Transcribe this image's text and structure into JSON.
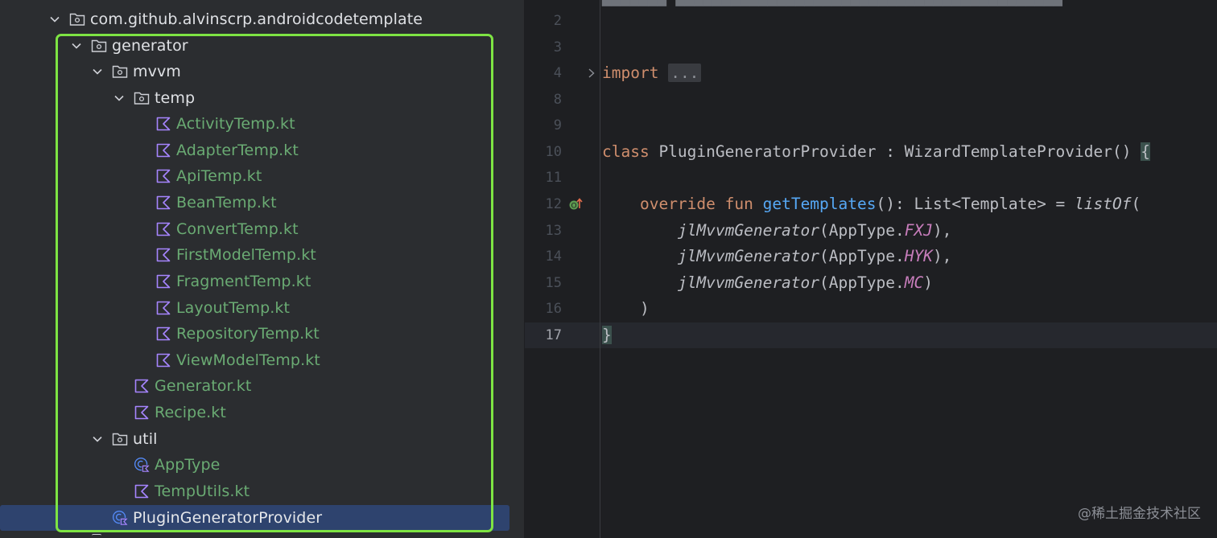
{
  "tree": {
    "root_package": "com.github.alvinscrp.androidcodetemplate",
    "generator": "generator",
    "mvvm": "mvvm",
    "temp": "temp",
    "temp_files": [
      "ActivityTemp.kt",
      "AdapterTemp.kt",
      "ApiTemp.kt",
      "BeanTemp.kt",
      "ConvertTemp.kt",
      "FirstModelTemp.kt",
      "FragmentTemp.kt",
      "LayoutTemp.kt",
      "RepositoryTemp.kt",
      "ViewModelTemp.kt"
    ],
    "mvvm_files": [
      "Generator.kt",
      "Recipe.kt"
    ],
    "util": "util",
    "util_files": [
      "AppType",
      "TempUtils.kt"
    ],
    "selected": "PluginGeneratorProvider"
  },
  "editor": {
    "line_numbers": [
      "2",
      "3",
      "4",
      "8",
      "9",
      "10",
      "11",
      "12",
      "13",
      "14",
      "15",
      "16",
      "17"
    ],
    "l4": {
      "kw": "import",
      "dots": "..."
    },
    "l10": {
      "kw": "class",
      "rest": " PluginGeneratorProvider : WizardTemplateProvider() ",
      "brace": "{"
    },
    "l12": {
      "kw": "override fun",
      "fn": "getTemplates",
      "rest": "(): List<Template> = ",
      "call": "listOf",
      "paren": "("
    },
    "l13": {
      "call": "jlMvvmGenerator",
      "pre": "(AppType.",
      "cst": "FXJ",
      "post": "),",
      "comma": ""
    },
    "l14": {
      "call": "jlMvvmGenerator",
      "pre": "(AppType.",
      "cst": "HYK",
      "post": "),"
    },
    "l15": {
      "call": "jlMvvmGenerator",
      "pre": "(AppType.",
      "cst": "MC",
      "post": ")"
    },
    "l16": ")",
    "l17": "}"
  },
  "watermark": "@稀土掘金技术社区"
}
